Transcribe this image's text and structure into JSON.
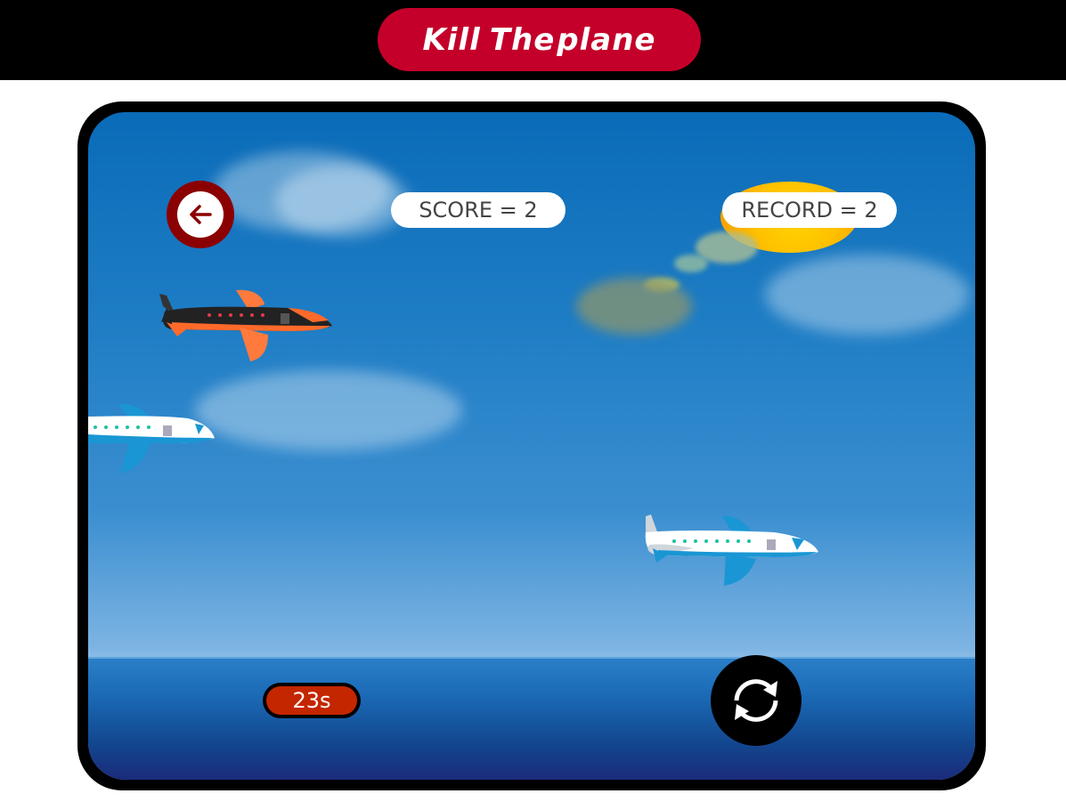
{
  "header": {
    "logo_word1": "Kill",
    "logo_word2": "The",
    "logo_word3": "plane",
    "background_color": "#000000",
    "logo_color": "#c4002a"
  },
  "game": {
    "back_icon": "arrow-left-icon",
    "score_text": "SCORE = 2",
    "record_text": "RECORD = 2",
    "timer_text": "23s",
    "reload_icon": "refresh-icon",
    "planes": [
      {
        "name": "orange-black-plane",
        "colors": [
          "#222222",
          "#ff6a2a"
        ],
        "direction": "right"
      },
      {
        "name": "blue-white-plane",
        "colors": [
          "#ffffff",
          "#1a96d4"
        ],
        "direction": "right"
      },
      {
        "name": "blue-white-plane",
        "colors": [
          "#ffffff",
          "#1a96d4"
        ],
        "direction": "right"
      }
    ]
  }
}
